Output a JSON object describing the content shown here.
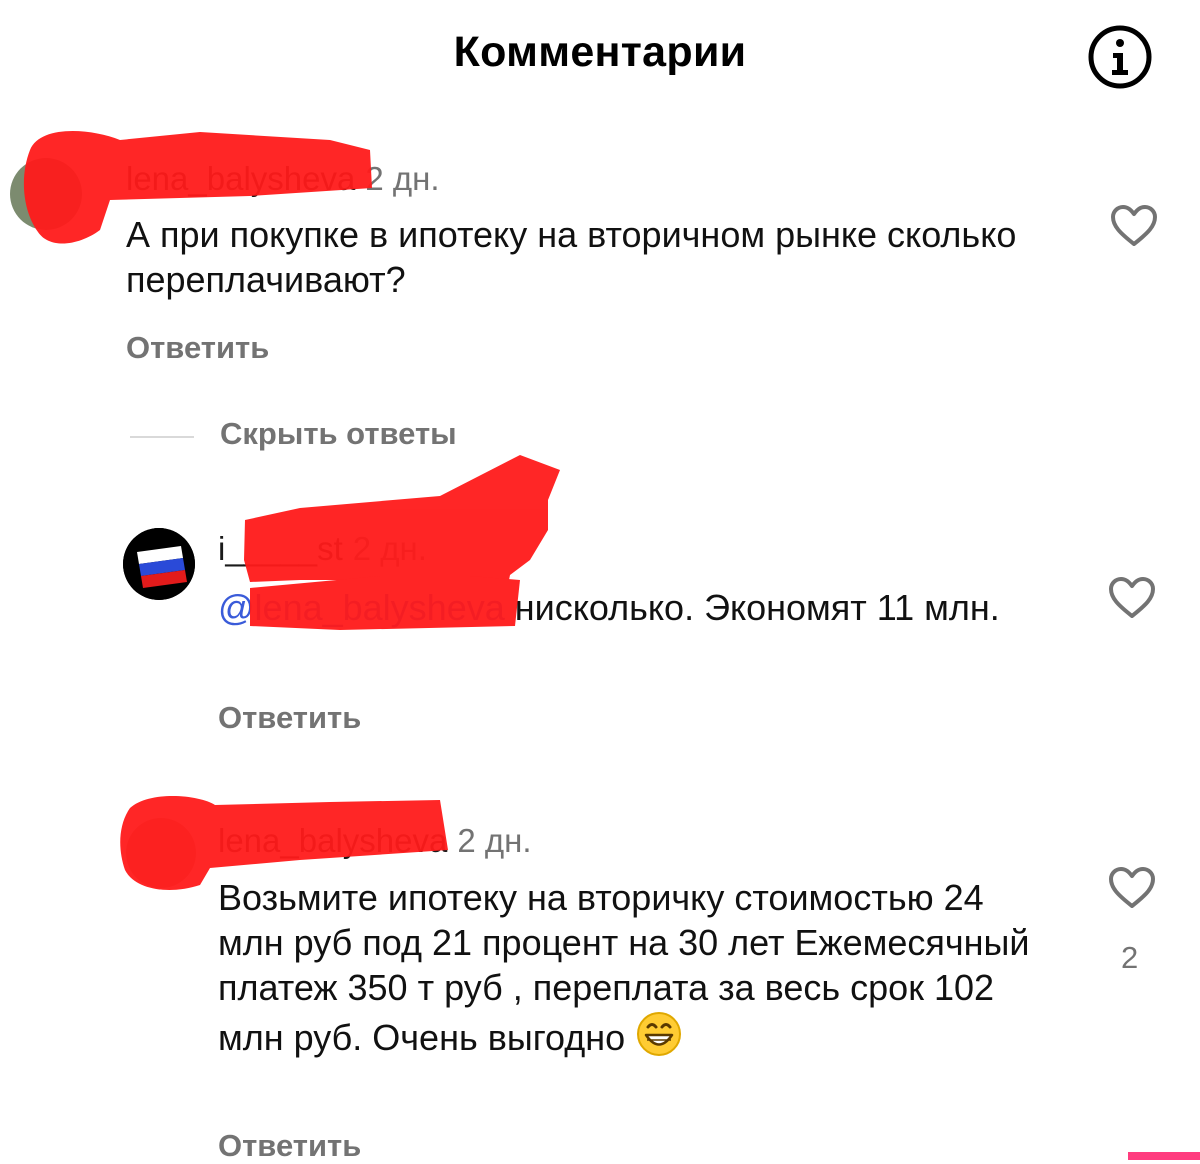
{
  "header": {
    "title": "Комментарии"
  },
  "icons": {
    "info": "info-icon",
    "like": "heart-icon",
    "emoji": "grinning-face-icon",
    "flag": "russia-flag-icon"
  },
  "colors": {
    "mention": "#3a5bd9",
    "secondary_text": "#737373",
    "redaction": "#ff1a1a"
  },
  "comments": [
    {
      "username": "lena_balysheva",
      "time": "2 дн.",
      "text": "А при покупке в ипотеку на вторичном рынке сколько переплачивают?",
      "reply_label": "Ответить",
      "likes": ""
    },
    {
      "username": "i_____st",
      "time": "2 дн.",
      "mention": "@lena_balysheva",
      "text": "нисколько. Экономят 11 млн.",
      "reply_label": "Ответить",
      "likes": ""
    },
    {
      "username": "lena_balysheva",
      "time": "2 дн.",
      "text": "Возьмите ипотеку на вторичку стоимостью 24 млн руб под 21 процент на 30 лет Ежемесячный платеж 350 т руб , переплата за весь срок 102 млн руб. Очень выгодно",
      "reply_label": "Ответить",
      "likes": "2"
    }
  ],
  "replies_toggle": {
    "label": "Скрыть ответы"
  }
}
